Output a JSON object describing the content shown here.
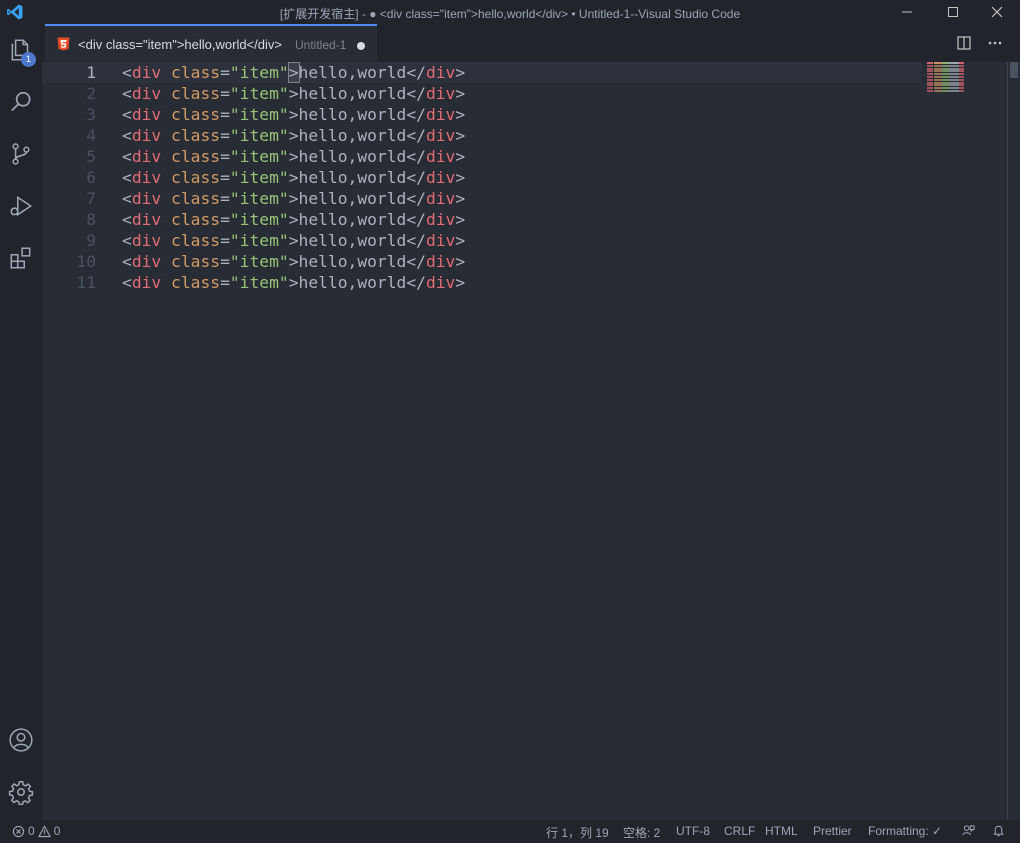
{
  "window": {
    "title": "[扩展开发宿主] - ● <div class=\"item\">hello,world</div> • Untitled-1--Visual Studio Code",
    "controls": [
      "minimize",
      "maximize",
      "close"
    ]
  },
  "activity_bar": {
    "items": [
      {
        "name": "explorer",
        "icon": "files-icon",
        "badge": "1"
      },
      {
        "name": "search",
        "icon": "search-icon"
      },
      {
        "name": "source-control",
        "icon": "source-control-icon"
      },
      {
        "name": "run-debug",
        "icon": "run-debug-icon"
      },
      {
        "name": "extensions",
        "icon": "extensions-icon"
      }
    ],
    "bottom": [
      {
        "name": "accounts",
        "icon": "account-icon"
      },
      {
        "name": "manage",
        "icon": "gear-icon"
      }
    ]
  },
  "tab": {
    "title": "<div class=\"item\">hello,world</div>",
    "description": "Untitled-1",
    "icon": "html5-icon",
    "dirty": true
  },
  "editor_actions": [
    "split-editor-icon",
    "more-actions-icon"
  ],
  "editor": {
    "current_line": 1,
    "line_numbers": [
      "1",
      "2",
      "3",
      "4",
      "5",
      "6",
      "7",
      "8",
      "9",
      "10",
      "11"
    ],
    "line_tokens": {
      "lt": "<",
      "tag": "div",
      "attr": "class",
      "eq": "=",
      "value": "\"item\"",
      "gt": ">",
      "text": "hello,world",
      "close_open": "</",
      "close_tag": "div",
      "close_gt": ">"
    }
  },
  "colors": {
    "background": "#282c34",
    "chrome": "#21252b",
    "tag": "#e06c75",
    "attribute": "#d19a66",
    "string": "#98c379",
    "text": "#abb2bf",
    "accent": "#528bff",
    "line_number": "#495162"
  },
  "status_bar": {
    "errors": "0",
    "warnings": "0",
    "position": "行 1，列 19",
    "indent": "空格: 2",
    "encoding": "UTF-8",
    "eol": "CRLF",
    "language": "HTML",
    "formatter": "Prettier",
    "formatting": "Formatting: ✓"
  }
}
